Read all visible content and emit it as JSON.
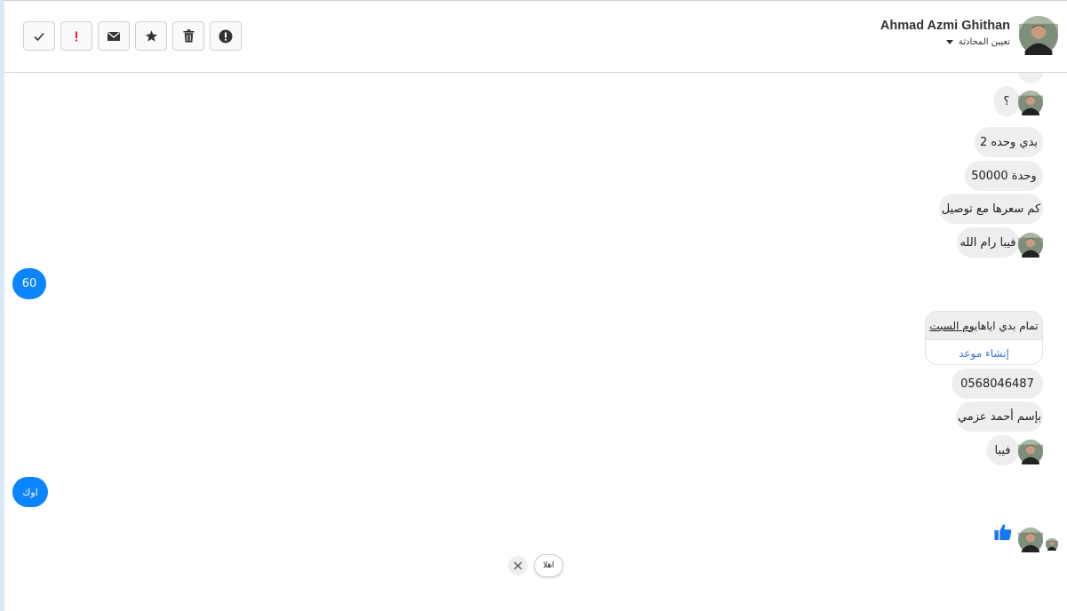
{
  "header": {
    "contact_name": "Ahmad Azmi Ghithan",
    "assign_label": "تعيين المحادثة",
    "toolbar": [
      {
        "icon": "check-icon"
      },
      {
        "icon": "exclamation-icon",
        "color": "#e02020"
      },
      {
        "icon": "envelope-icon"
      },
      {
        "icon": "star-icon"
      },
      {
        "icon": "trash-icon"
      },
      {
        "icon": "alert-circle-icon"
      }
    ]
  },
  "messages": [
    {
      "text": "؟",
      "direction": "incoming"
    },
    {
      "text": "بدي وحده 2",
      "direction": "incoming"
    },
    {
      "text": "وحدة 50000",
      "direction": "incoming"
    },
    {
      "text": "كم سعرها مع توصيل",
      "direction": "incoming"
    },
    {
      "text": "فيبا رام الله",
      "direction": "incoming"
    },
    {
      "text": "60",
      "direction": "outgoing"
    },
    {
      "text": "0568046487",
      "direction": "incoming"
    },
    {
      "text": "بإسم أحمد عزمي",
      "direction": "incoming"
    },
    {
      "text": "فيبا",
      "direction": "incoming"
    },
    {
      "text": "اوك",
      "direction": "outgoing"
    }
  ],
  "appointment_card": {
    "text_before": "تمام بدي اياها ",
    "text_underlined": "يوم السبت",
    "action_label": "إنشاء موعد"
  },
  "quick_reply": {
    "label": "اهلا"
  },
  "colors": {
    "outgoing_bubble": "#0a84ff",
    "incoming_bubble": "#eeeeee",
    "like": "#1877f2",
    "link": "#3b72d9"
  }
}
